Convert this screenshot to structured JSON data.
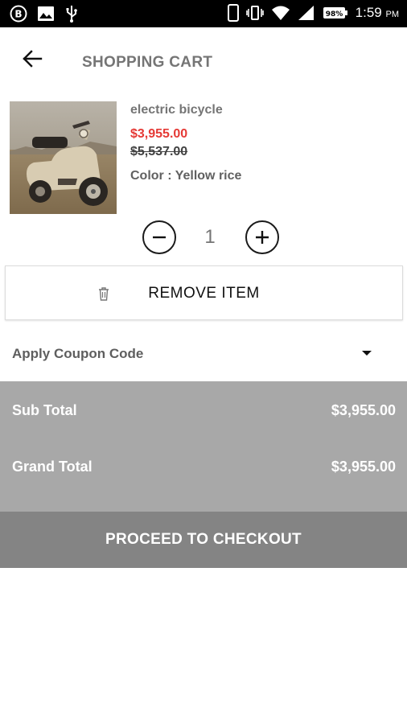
{
  "status_bar": {
    "time": "1:59",
    "ampm": "PM",
    "battery": "98%",
    "left_icons": [
      "b-circle-icon",
      "image-icon",
      "usb-icon"
    ],
    "right_icons": [
      "phone-icon",
      "vibrate-icon",
      "wifi-icon",
      "signal-icon",
      "battery-icon"
    ]
  },
  "header": {
    "title": "SHOPPING CART",
    "back_icon": "arrow-left-icon"
  },
  "product": {
    "name": "electric bicycle",
    "sale_price": "$3,955.00",
    "original_price": "$5,537.00",
    "color": "Color : Yellow rice",
    "quantity": "1"
  },
  "actions": {
    "remove_label": "REMOVE ITEM",
    "coupon_label": "Apply Coupon Code",
    "checkout_label": "PROCEED TO CHECKOUT"
  },
  "totals": {
    "sub_total_label": "Sub Total",
    "sub_total_value": "$3,955.00",
    "grand_total_label": "Grand Total",
    "grand_total_value": "$3,955.00"
  },
  "colors": {
    "sale_price": "#e53935",
    "totals_bg": "#a8a8a8",
    "checkout_bg": "#848484",
    "title": "#757575"
  }
}
